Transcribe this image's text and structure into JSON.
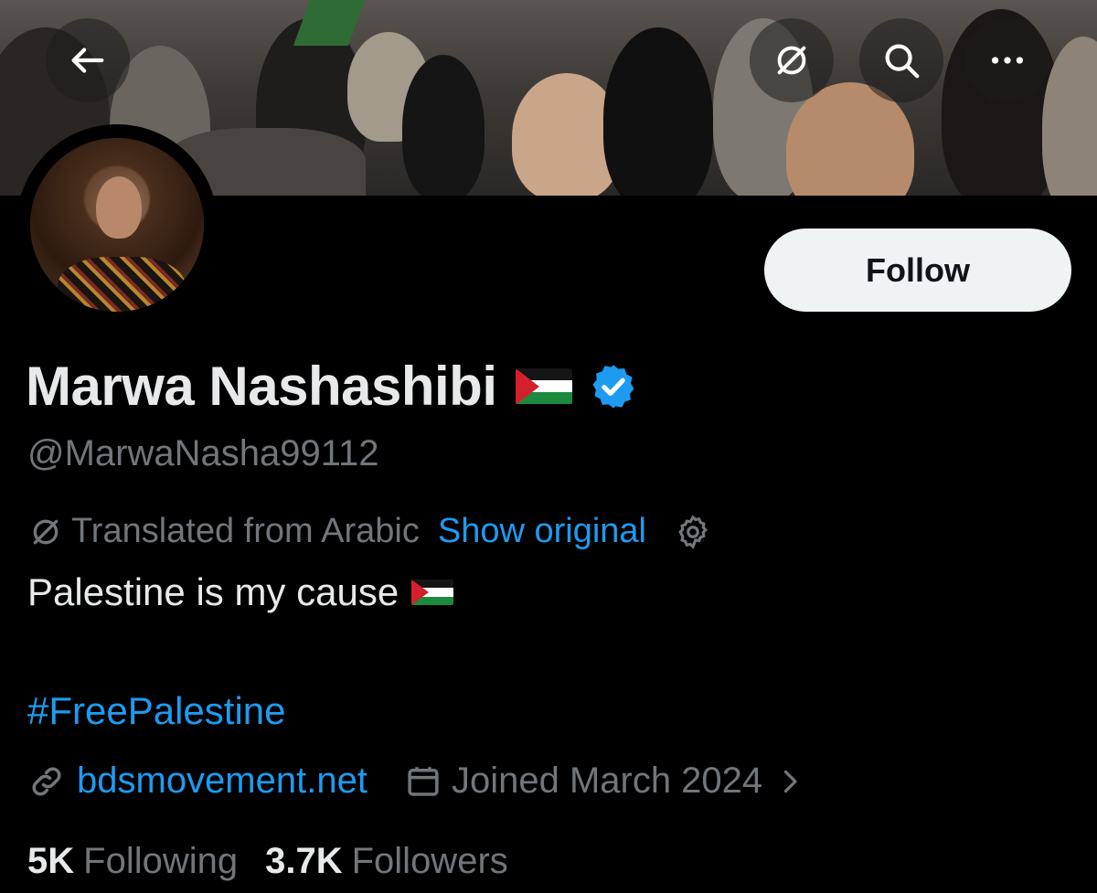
{
  "header": {
    "back_icon": "arrow-left-icon",
    "translate_icon": "translate-slash-icon",
    "search_icon": "search-icon",
    "more_icon": "more-horizontal-icon"
  },
  "profile": {
    "name": "Marwa Nashashibi",
    "name_flag": "palestine-flag",
    "verified_icon": "verified-badge-icon",
    "verified_color": "#1d9bf0",
    "handle": "@MarwaNasha99112",
    "follow_label": "Follow"
  },
  "bio": {
    "translated_label": "Translated from Arabic",
    "show_original_label": "Show original",
    "settings_icon": "gear-icon",
    "text": "Palestine is my cause",
    "hashtag": "#FreePalestine"
  },
  "meta": {
    "link_icon": "link-icon",
    "website": "bdsmovement.net",
    "calendar_icon": "calendar-icon",
    "joined": "Joined March 2024",
    "chevron_icon": "chevron-right-icon"
  },
  "stats": {
    "following_count": "5K",
    "following_label": "Following",
    "followers_count": "3.7K",
    "followers_label": "Followers"
  },
  "colors": {
    "accent": "#1d9bf0",
    "background": "#000000",
    "text": "#e7e9ea",
    "muted": "#71767b"
  }
}
